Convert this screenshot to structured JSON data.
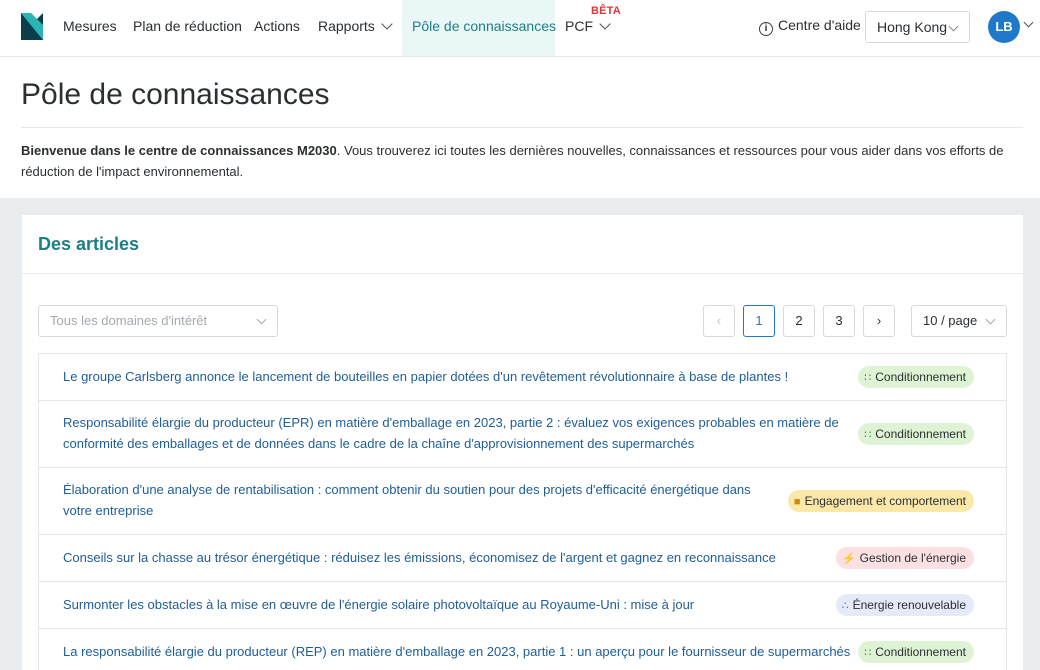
{
  "nav": {
    "items": [
      {
        "label": "Mesures"
      },
      {
        "label": "Plan de réduction"
      },
      {
        "label": "Actions"
      },
      {
        "label": "Rapports"
      },
      {
        "label": "Pôle de connaissances",
        "active": true
      },
      {
        "label": "PCF"
      }
    ],
    "beta_badge": "BÊTA",
    "help_label": "Centre d'aide",
    "region": "Hong Kong",
    "avatar_initials": "LB"
  },
  "page": {
    "title": "Pôle de connaissances",
    "intro_bold": "Bienvenue dans le centre de connaissances M2030",
    "intro_rest": ". Vous trouverez ici toutes les dernières nouvelles, connaissances et ressources pour vous aider dans vos efforts de réduction de l'impact environnemental."
  },
  "articles": {
    "heading": "Des articles",
    "filter_placeholder": "Tous les domaines d'intérêt",
    "pagination": {
      "pages": [
        "1",
        "2",
        "3"
      ],
      "current": "1",
      "page_size": "10 / page"
    },
    "items": [
      {
        "title": "Le groupe Carlsberg annonce le lancement de bouteilles en papier dotées d'un revêtement révolutionnaire à base de plantes !",
        "tag": "Conditionnement",
        "tag_icon": "packaging-icon",
        "tag_color": "#def3d3"
      },
      {
        "title": "Responsabilité élargie du producteur (EPR) en matière d'emballage en 2023, partie 2 : évaluez vos exigences probables en matière de conformité des emballages et de données dans le cadre de la chaîne d'approvisionnement des supermarchés",
        "tag": "Conditionnement",
        "tag_icon": "packaging-icon",
        "tag_color": "#def3d3"
      },
      {
        "title": "Élaboration d'une analyse de rentabilisation : comment obtenir du soutien pour des projets d'efficacité énergétique dans votre entreprise",
        "tag": "Engagement et comportement",
        "tag_icon": "folder-icon",
        "tag_color": "#fbe8a8"
      },
      {
        "title": "Conseils sur la chasse au trésor énergétique : réduisez les émissions, économisez de l'argent et gagnez en reconnaissance",
        "tag": "Gestion de l'énergie",
        "tag_icon": "lightning-icon",
        "tag_color": "#fbe0e2"
      },
      {
        "title": "Surmonter les obstacles à la mise en œuvre de l'énergie solaire photovoltaïque au Royaume-Uni : mise à jour",
        "tag": "Énergie renouvelable",
        "tag_icon": "dots-icon",
        "tag_color": "#e5e9f8"
      },
      {
        "title": "La responsabilité élargie du producteur (REP) en matière d'emballage en 2023, partie 1 : un aperçu pour le fournisseur de supermarchés",
        "tag": "Conditionnement",
        "tag_icon": "packaging-icon",
        "tag_color": "#def3d3"
      }
    ]
  }
}
